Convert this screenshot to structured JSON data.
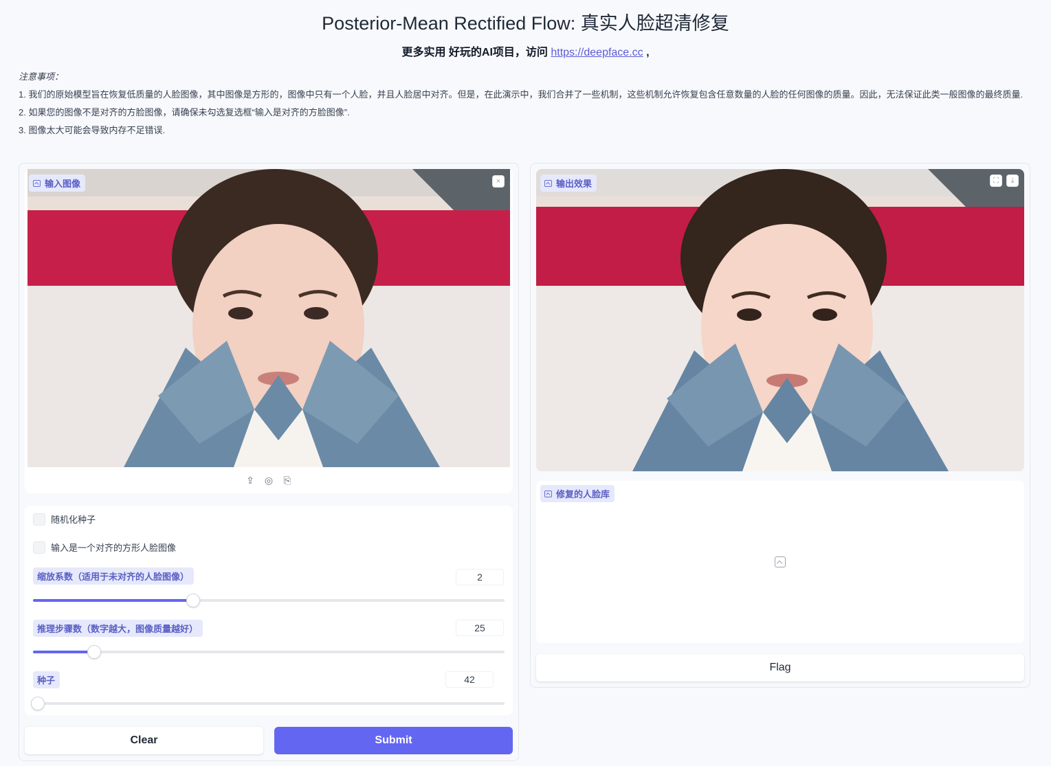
{
  "header": {
    "title": "Posterior-Mean Rectified Flow: 真实人脸超清修复",
    "subtitle_prefix": "更多实用 好玩的AI项目，访问 ",
    "subtitle_link": "https://deepface.cc",
    "subtitle_suffix": " ,"
  },
  "notes": {
    "heading": "注意事项：",
    "items": [
      "1. 我们的原始模型旨在恢复低质量的人脸图像，其中图像是方形的，图像中只有一个人脸，并且人脸居中对齐。但是，在此演示中，我们合并了一些机制，这些机制允许恢复包含任意数量的人脸的任何图像的质量。因此，无法保证此类一般图像的最终质量.",
      "2. 如果您的图像不是对齐的方脸图像，请确保未勾选复选框“输入是对齐的方脸图像”.",
      "3. 图像太大可能会导致内存不足错误."
    ]
  },
  "input_panel": {
    "image_label": "输入图像",
    "close_icon": "×",
    "toolbar": {
      "upload_icon": "⇪",
      "webcam_icon": "◎",
      "paste_icon": "⎘"
    },
    "checkboxes": [
      {
        "label": "随机化种子",
        "checked": false
      },
      {
        "label": "输入是一个对齐的方形人脸图像",
        "checked": false
      }
    ],
    "sliders": [
      {
        "label": "缩放系数（适用于未对齐的人脸图像）",
        "value": "2",
        "fraction": 0.34
      },
      {
        "label": "推理步骤数（数字越大，图像质量越好）",
        "value": "25",
        "fraction": 0.13
      },
      {
        "label": "种子",
        "value": "42",
        "fraction": 0.01
      }
    ],
    "clear_label": "Clear",
    "submit_label": "Submit"
  },
  "output_panel": {
    "image_label": "输出效果",
    "fullscreen_icon": "⛶",
    "download_icon": "⤓",
    "gallery_label": "修复的人脸库",
    "gallery_placeholder_icon": "image-icon",
    "flag_label": "Flag"
  },
  "colors": {
    "accent": "#6366f1",
    "chip_bg": "#e6e9fb",
    "chip_text": "#5a5fc4",
    "link": "#5b5bd6"
  }
}
